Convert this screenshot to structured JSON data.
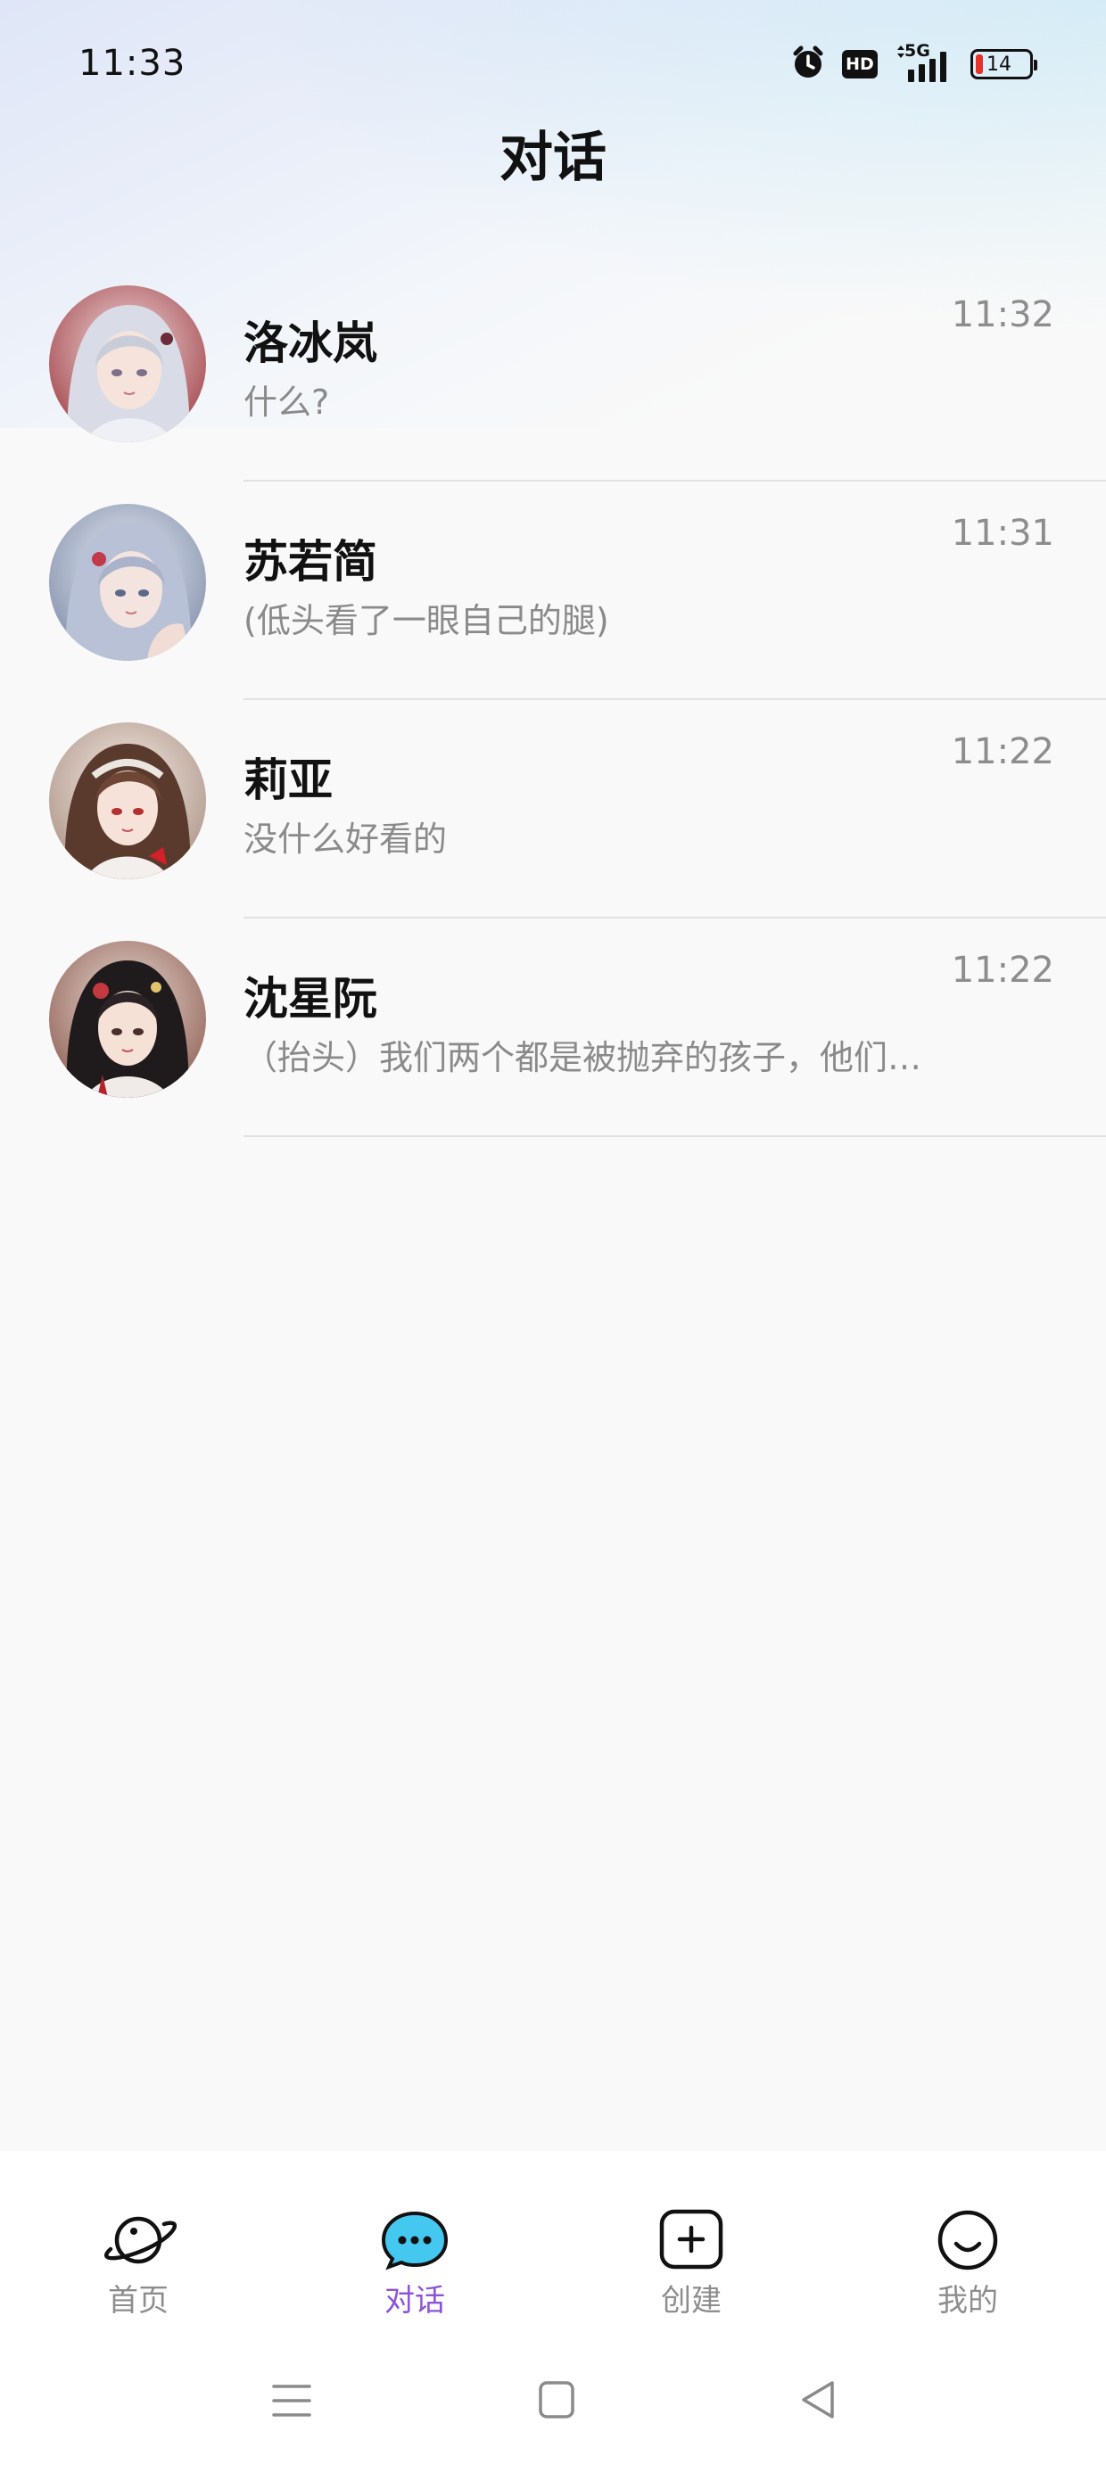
{
  "status_bar": {
    "time": "11:33",
    "hd_label": "HD",
    "network_label": "5G",
    "battery_level": "14",
    "icons": [
      "alarm-clock-icon",
      "hd-icon",
      "5g-signal-icon",
      "battery-icon"
    ]
  },
  "header": {
    "title": "对话"
  },
  "conversations": [
    {
      "name": "洛冰岚",
      "time": "11:32",
      "preview": "什么?",
      "avatar": "avatar-luobinglan"
    },
    {
      "name": "苏若简",
      "time": "11:31",
      "preview": "(低头看了一眼自己的腿)",
      "avatar": "avatar-suruojian"
    },
    {
      "name": "莉亚",
      "time": "11:22",
      "preview": "没什么好看的",
      "avatar": "avatar-liya"
    },
    {
      "name": "沈星阮",
      "time": "11:22",
      "preview": "（抬头）我们两个都是被抛弃的孩子，他们…",
      "avatar": "avatar-shenxingruan"
    }
  ],
  "bottom_nav": {
    "tabs": [
      {
        "label": "首页",
        "icon": "planet-icon",
        "active": false
      },
      {
        "label": "对话",
        "icon": "chat-bubble-icon",
        "active": true
      },
      {
        "label": "创建",
        "icon": "plus-square-icon",
        "active": false
      },
      {
        "label": "我的",
        "icon": "smile-icon",
        "active": false
      }
    ],
    "active_color": "#8d54d8",
    "inactive_color": "#8d8d8d"
  },
  "system_nav": {
    "buttons": [
      "menu-icon",
      "home-square-icon",
      "back-triangle-icon"
    ]
  }
}
